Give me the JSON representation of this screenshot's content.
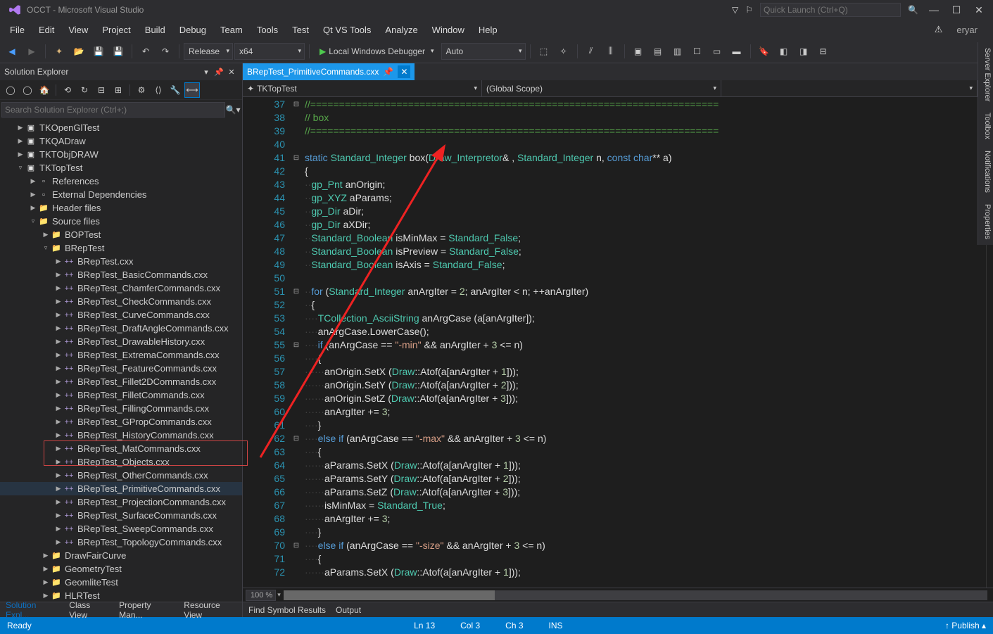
{
  "title": "OCCT - Microsoft Visual Studio",
  "quick_launch_placeholder": "Quick Launch (Ctrl+Q)",
  "user": "eryar",
  "menus": [
    "File",
    "Edit",
    "View",
    "Project",
    "Build",
    "Debug",
    "Team",
    "Tools",
    "Test",
    "Qt VS Tools",
    "Analyze",
    "Window",
    "Help"
  ],
  "toolbar": {
    "config": "Release",
    "platform": "x64",
    "run_label": "Local Windows Debugger",
    "auto": "Auto"
  },
  "solution_explorer": {
    "title": "Solution Explorer",
    "search_placeholder": "Search Solution Explorer (Ctrl+;)",
    "tree": [
      {
        "d": 1,
        "icn": "proj",
        "exp": "▶",
        "label": "TKOpenGlTest"
      },
      {
        "d": 1,
        "icn": "proj",
        "exp": "▶",
        "label": "TKQADraw"
      },
      {
        "d": 1,
        "icn": "proj",
        "exp": "▶",
        "label": "TKTObjDRAW"
      },
      {
        "d": 1,
        "icn": "proj",
        "exp": "▿",
        "label": "TKTopTest"
      },
      {
        "d": 2,
        "icn": "ref",
        "exp": "▶",
        "label": "References"
      },
      {
        "d": 2,
        "icn": "ref",
        "exp": "▶",
        "label": "External Dependencies"
      },
      {
        "d": 2,
        "icn": "fldr",
        "exp": "▶",
        "label": "Header files"
      },
      {
        "d": 2,
        "icn": "fldr",
        "exp": "▿",
        "label": "Source files"
      },
      {
        "d": 3,
        "icn": "fldr",
        "exp": "▶",
        "label": "BOPTest"
      },
      {
        "d": 3,
        "icn": "fldr",
        "exp": "▿",
        "label": "BRepTest"
      },
      {
        "d": 4,
        "icn": "cpp",
        "exp": "▶",
        "label": "BRepTest.cxx"
      },
      {
        "d": 4,
        "icn": "cpp",
        "exp": "▶",
        "label": "BRepTest_BasicCommands.cxx"
      },
      {
        "d": 4,
        "icn": "cpp",
        "exp": "▶",
        "label": "BRepTest_ChamferCommands.cxx"
      },
      {
        "d": 4,
        "icn": "cpp",
        "exp": "▶",
        "label": "BRepTest_CheckCommands.cxx"
      },
      {
        "d": 4,
        "icn": "cpp",
        "exp": "▶",
        "label": "BRepTest_CurveCommands.cxx"
      },
      {
        "d": 4,
        "icn": "cpp",
        "exp": "▶",
        "label": "BRepTest_DraftAngleCommands.cxx"
      },
      {
        "d": 4,
        "icn": "cpp",
        "exp": "▶",
        "label": "BRepTest_DrawableHistory.cxx"
      },
      {
        "d": 4,
        "icn": "cpp",
        "exp": "▶",
        "label": "BRepTest_ExtremaCommands.cxx"
      },
      {
        "d": 4,
        "icn": "cpp",
        "exp": "▶",
        "label": "BRepTest_FeatureCommands.cxx"
      },
      {
        "d": 4,
        "icn": "cpp",
        "exp": "▶",
        "label": "BRepTest_Fillet2DCommands.cxx"
      },
      {
        "d": 4,
        "icn": "cpp",
        "exp": "▶",
        "label": "BRepTest_FilletCommands.cxx"
      },
      {
        "d": 4,
        "icn": "cpp",
        "exp": "▶",
        "label": "BRepTest_FillingCommands.cxx"
      },
      {
        "d": 4,
        "icn": "cpp",
        "exp": "▶",
        "label": "BRepTest_GPropCommands.cxx"
      },
      {
        "d": 4,
        "icn": "cpp",
        "exp": "▶",
        "label": "BRepTest_HistoryCommands.cxx"
      },
      {
        "d": 4,
        "icn": "cpp",
        "exp": "▶",
        "label": "BRepTest_MatCommands.cxx"
      },
      {
        "d": 4,
        "icn": "cpp",
        "exp": "▶",
        "label": "BRepTest_Objects.cxx"
      },
      {
        "d": 4,
        "icn": "cpp",
        "exp": "▶",
        "label": "BRepTest_OtherCommands.cxx"
      },
      {
        "d": 4,
        "icn": "cpp",
        "exp": "▶",
        "label": "BRepTest_PrimitiveCommands.cxx",
        "sel": true
      },
      {
        "d": 4,
        "icn": "cpp",
        "exp": "▶",
        "label": "BRepTest_ProjectionCommands.cxx"
      },
      {
        "d": 4,
        "icn": "cpp",
        "exp": "▶",
        "label": "BRepTest_SurfaceCommands.cxx"
      },
      {
        "d": 4,
        "icn": "cpp",
        "exp": "▶",
        "label": "BRepTest_SweepCommands.cxx"
      },
      {
        "d": 4,
        "icn": "cpp",
        "exp": "▶",
        "label": "BRepTest_TopologyCommands.cxx"
      },
      {
        "d": 3,
        "icn": "fldr",
        "exp": "▶",
        "label": "DrawFairCurve"
      },
      {
        "d": 3,
        "icn": "fldr",
        "exp": "▶",
        "label": "GeometryTest"
      },
      {
        "d": 3,
        "icn": "fldr",
        "exp": "▶",
        "label": "GeomliteTest"
      },
      {
        "d": 3,
        "icn": "fldr",
        "exp": "▶",
        "label": "HLRTest"
      }
    ],
    "bottom_tabs": [
      "Solution Expl...",
      "Class View",
      "Property Man...",
      "Resource View"
    ]
  },
  "editor": {
    "tab_name": "BRepTest_PrimitiveCommands.cxx",
    "nav_left": "TKTopTest",
    "nav_right": "(Global Scope)",
    "zoom": "100 %",
    "first_line": 37,
    "fold": [
      "⊟",
      "",
      "",
      "",
      "⊟",
      "",
      "",
      "",
      "",
      "",
      "",
      "",
      "",
      "",
      "⊟",
      "",
      "",
      "",
      "⊟",
      "",
      "",
      "",
      "",
      "",
      "",
      "⊟",
      "",
      "",
      "",
      "",
      "",
      "",
      "",
      "⊟",
      "",
      ""
    ],
    "code": [
      "<span class='cline'>//=======================================================================</span>",
      "<span class='comment'>// box</span>",
      "<span class='cline'>//=======================================================================</span>",
      "",
      "<span class='kw'>static</span> <span class='type'>Standard_Integer</span> <span class='func'>box</span>(<span class='type'>Draw_Interpretor</span>&amp; , <span class='type'>Standard_Integer</span> n, <span class='kw'>const</span> <span class='kw'>char</span>** a)",
      "{",
      "<span class='ws'>··</span><span class='type'>gp_Pnt</span> anOrigin;",
      "<span class='ws'>··</span><span class='type'>gp_XYZ</span> aParams;",
      "<span class='ws'>··</span><span class='type'>gp_Dir</span> aDir;",
      "<span class='ws'>··</span><span class='type'>gp_Dir</span> aXDir;",
      "<span class='ws'>··</span><span class='type'>Standard_Boolean</span> isMinMax = <span class='type'>Standard_False</span>;",
      "<span class='ws'>··</span><span class='type'>Standard_Boolean</span> isPreview = <span class='type'>Standard_False</span>;",
      "<span class='ws'>··</span><span class='type'>Standard_Boolean</span> isAxis = <span class='type'>Standard_False</span>;",
      "",
      "<span class='ws'>··</span><span class='kw'>for</span> (<span class='type'>Standard_Integer</span> anArgIter = <span class='num'>2</span>; anArgIter &lt; n; ++anArgIter)",
      "<span class='ws'>··</span>{",
      "<span class='ws'>····</span><span class='type'>TCollection_AsciiString</span> anArgCase (a[anArgIter]);",
      "<span class='ws'>····</span>anArgCase.LowerCase();",
      "<span class='ws'>····</span><span class='kw'>if</span> (anArgCase == <span class='str'>\"-min\"</span> &amp;&amp; anArgIter + <span class='num'>3</span> &lt;= n)",
      "<span class='ws'>····</span>{",
      "<span class='ws'>······</span>anOrigin.SetX (<span class='type'>Draw</span>::Atof(a[anArgIter + <span class='num'>1</span>]));",
      "<span class='ws'>······</span>anOrigin.SetY (<span class='type'>Draw</span>::Atof(a[anArgIter + <span class='num'>2</span>]));",
      "<span class='ws'>······</span>anOrigin.SetZ (<span class='type'>Draw</span>::Atof(a[anArgIter + <span class='num'>3</span>]));",
      "<span class='ws'>······</span>anArgIter += <span class='num'>3</span>;",
      "<span class='ws'>····</span>}",
      "<span class='ws'>····</span><span class='kw'>else</span> <span class='kw'>if</span> (anArgCase == <span class='str'>\"-max\"</span> &amp;&amp; anArgIter + <span class='num'>3</span> &lt;= n)",
      "<span class='ws'>····</span>{",
      "<span class='ws'>······</span>aParams.SetX (<span class='type'>Draw</span>::Atof(a[anArgIter + <span class='num'>1</span>]));",
      "<span class='ws'>······</span>aParams.SetY (<span class='type'>Draw</span>::Atof(a[anArgIter + <span class='num'>2</span>]));",
      "<span class='ws'>······</span>aParams.SetZ (<span class='type'>Draw</span>::Atof(a[anArgIter + <span class='num'>3</span>]));",
      "<span class='ws'>······</span>isMinMax = <span class='type'>Standard_True</span>;",
      "<span class='ws'>······</span>anArgIter += <span class='num'>3</span>;",
      "<span class='ws'>····</span>}",
      "<span class='ws'>····</span><span class='kw'>else</span> <span class='kw'>if</span> (anArgCase == <span class='str'>\"-size\"</span> &amp;&amp; anArgIter + <span class='num'>3</span> &lt;= n)",
      "<span class='ws'>····</span>{",
      "<span class='ws'>······</span>aParams.SetX (<span class='type'>Draw</span>::Atof(a[anArgIter + <span class='num'>1</span>]));"
    ]
  },
  "output_tabs": [
    "Find Symbol Results",
    "Output"
  ],
  "status": {
    "ready": "Ready",
    "ln": "Ln 13",
    "col": "Col 3",
    "ch": "Ch 3",
    "ins": "INS",
    "publish": "Publish ▴"
  },
  "side_panels": [
    "Server Explorer",
    "Toolbox",
    "Notifications",
    "Properties"
  ]
}
